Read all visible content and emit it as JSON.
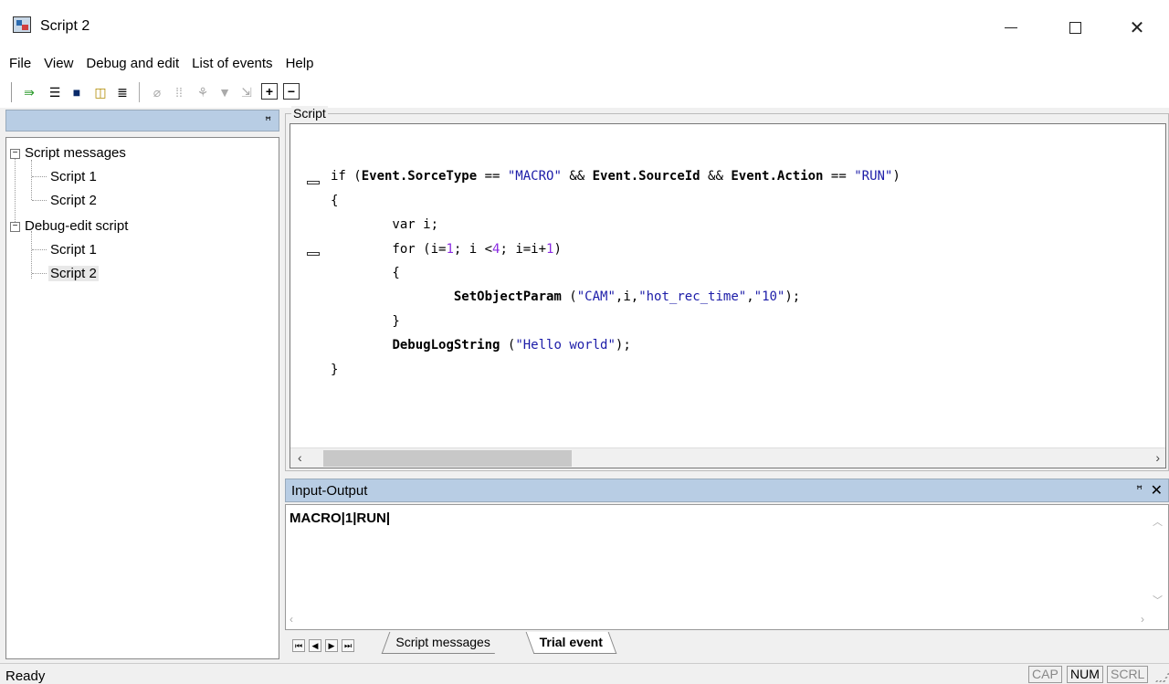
{
  "window": {
    "title": "Script 2"
  },
  "menu": [
    "File",
    "View",
    "Debug and edit",
    "List of events",
    "Help"
  ],
  "tree": {
    "groups": [
      {
        "label": "Script messages",
        "children": [
          "Script 1",
          "Script 2"
        ]
      },
      {
        "label": "Debug-edit script",
        "children": [
          "Script 1",
          "Script 2"
        ]
      }
    ],
    "selected": "Script 2"
  },
  "script": {
    "legend": "Script",
    "lines": [
      "if (Event.SorceType == \"MACRO\" && Event.SourceId && Event.Action == \"RUN\")",
      "{",
      "        var i;",
      "        for (i=1; i <4; i=i+1)",
      "        {",
      "                SetObjectParam (\"CAM\",i,\"hot_rec_time\",\"10\");",
      "        }",
      "        DebugLogString (\"Hello world\");",
      "}"
    ]
  },
  "io": {
    "title": "Input-Output",
    "content": "MACRO|1|RUN|"
  },
  "tabs": [
    "Script messages",
    "Trial event"
  ],
  "active_tab": "Trial event",
  "status": {
    "text": "Ready",
    "indicators": [
      {
        "label": "CAP",
        "active": false
      },
      {
        "label": "NUM",
        "active": true
      },
      {
        "label": "SCRL",
        "active": false
      }
    ]
  },
  "icons": {
    "pin": "pin-icon",
    "close": "close-icon"
  }
}
